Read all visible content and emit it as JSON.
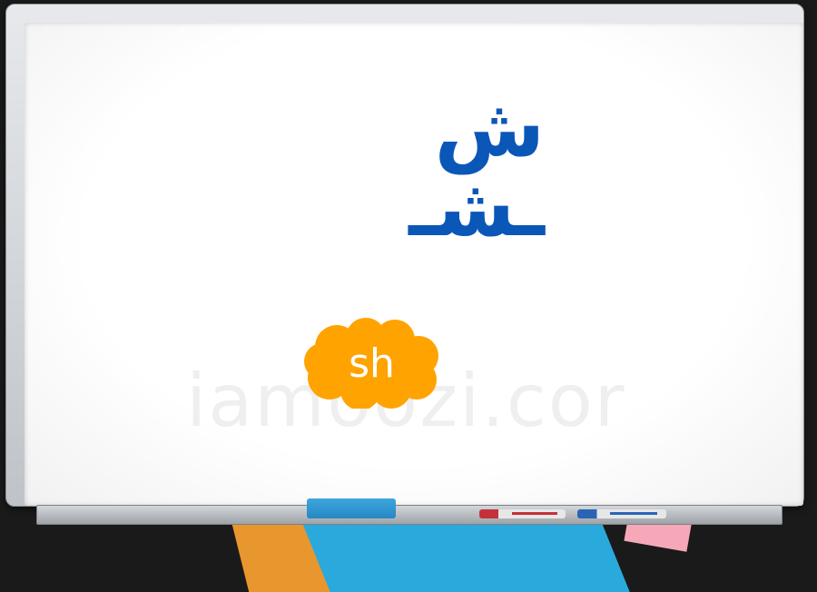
{
  "board": {
    "letters": "ش ـشـ",
    "transliteration": "sh",
    "watermark": "iamoozi.cor"
  },
  "colors": {
    "letter": "#0b57b8",
    "cloud": "#ffa300",
    "cloud_text": "#ffffff"
  },
  "icons": [
    "whiteboard-frame",
    "cloud-shape",
    "eraser-icon",
    "red-marker-icon",
    "blue-marker-icon"
  ]
}
